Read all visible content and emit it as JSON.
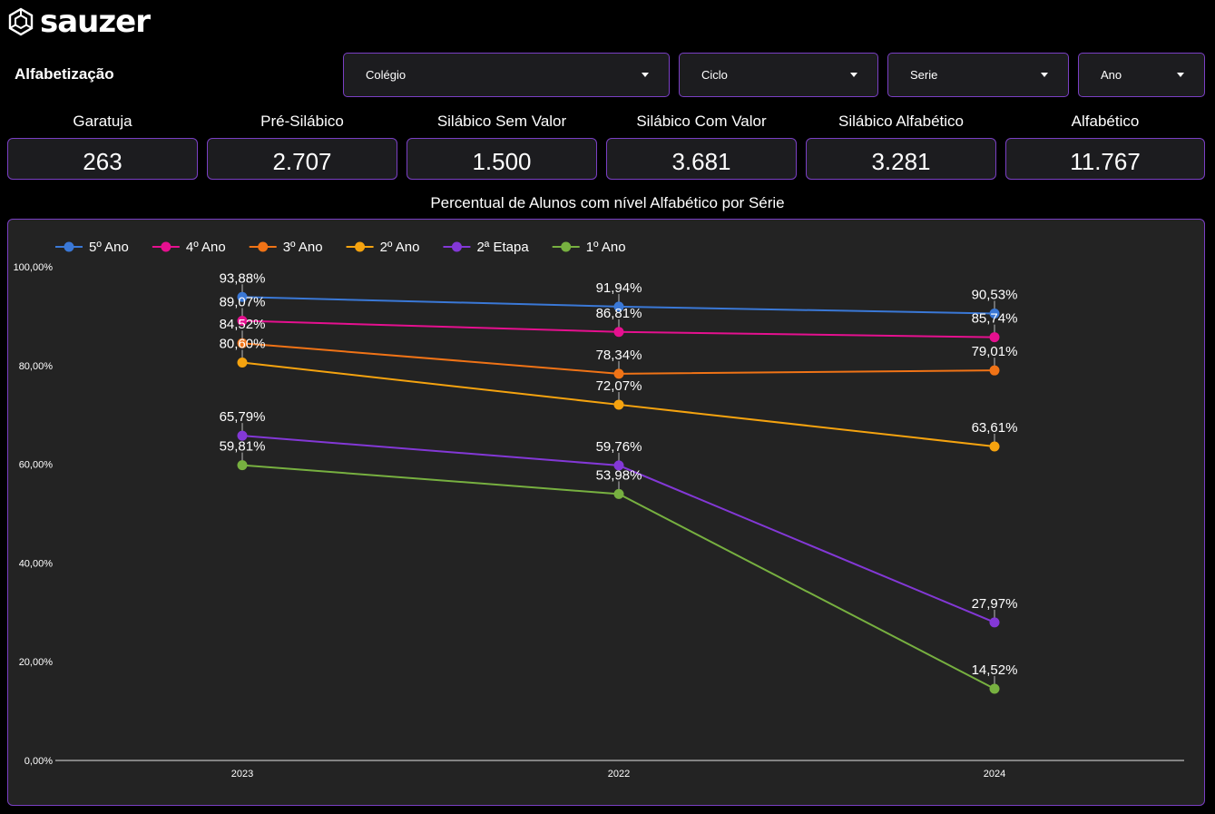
{
  "brand": {
    "logo_text": "sauzer"
  },
  "page": {
    "title": "Alfabetização"
  },
  "filters": [
    {
      "label": "Colégio"
    },
    {
      "label": "Ciclo"
    },
    {
      "label": "Serie"
    },
    {
      "label": "Ano"
    }
  ],
  "kpis": [
    {
      "label": "Garatuja",
      "value": "263"
    },
    {
      "label": "Pré-Silábico",
      "value": "2.707"
    },
    {
      "label": "Silábico Sem Valor",
      "value": "1.500"
    },
    {
      "label": "Silábico Com Valor",
      "value": "3.681"
    },
    {
      "label": "Silábico Alfabético",
      "value": "3.281"
    },
    {
      "label": "Alfabético",
      "value": "11.767"
    }
  ],
  "colors": {
    "accent_border": "#7a3fc4",
    "panel_bg": "#232323"
  },
  "chart_data": {
    "type": "line",
    "title": "Percentual de Alunos com nível Alfabético por Série",
    "xlabel": "",
    "ylabel": "",
    "categories": [
      "2023",
      "2022",
      "2024"
    ],
    "ylim": [
      0,
      100
    ],
    "yticks": [
      "0,00%",
      "20,00%",
      "40,00%",
      "60,00%",
      "80,00%",
      "100,00%"
    ],
    "grid": false,
    "legend_position": "top-left",
    "series": [
      {
        "name": "5º Ano",
        "color": "#3a78d6",
        "values": [
          93.88,
          91.94,
          90.53
        ],
        "labels": [
          "93,88%",
          "91,94%",
          "90,53%"
        ]
      },
      {
        "name": "4º Ano",
        "color": "#e5108f",
        "values": [
          89.07,
          86.81,
          85.74
        ],
        "labels": [
          "89,07%",
          "86,81%",
          "85,74%"
        ]
      },
      {
        "name": "3º Ano",
        "color": "#f07316",
        "values": [
          84.52,
          78.34,
          79.01
        ],
        "labels": [
          "84,52%",
          "78,34%",
          "79,01%"
        ]
      },
      {
        "name": "2º Ano",
        "color": "#f5a30f",
        "values": [
          80.6,
          72.07,
          63.61
        ],
        "labels": [
          "80,60%",
          "72,07%",
          "63,61%"
        ]
      },
      {
        "name": "2ª Etapa",
        "color": "#8338d6",
        "values": [
          65.79,
          59.76,
          27.97
        ],
        "labels": [
          "65,79%",
          "59,76%",
          "27,97%"
        ]
      },
      {
        "name": "1º Ano",
        "color": "#77b040",
        "values": [
          59.81,
          53.98,
          14.52
        ],
        "labels": [
          "59,81%",
          "53,98%",
          "14,52%"
        ]
      }
    ]
  }
}
